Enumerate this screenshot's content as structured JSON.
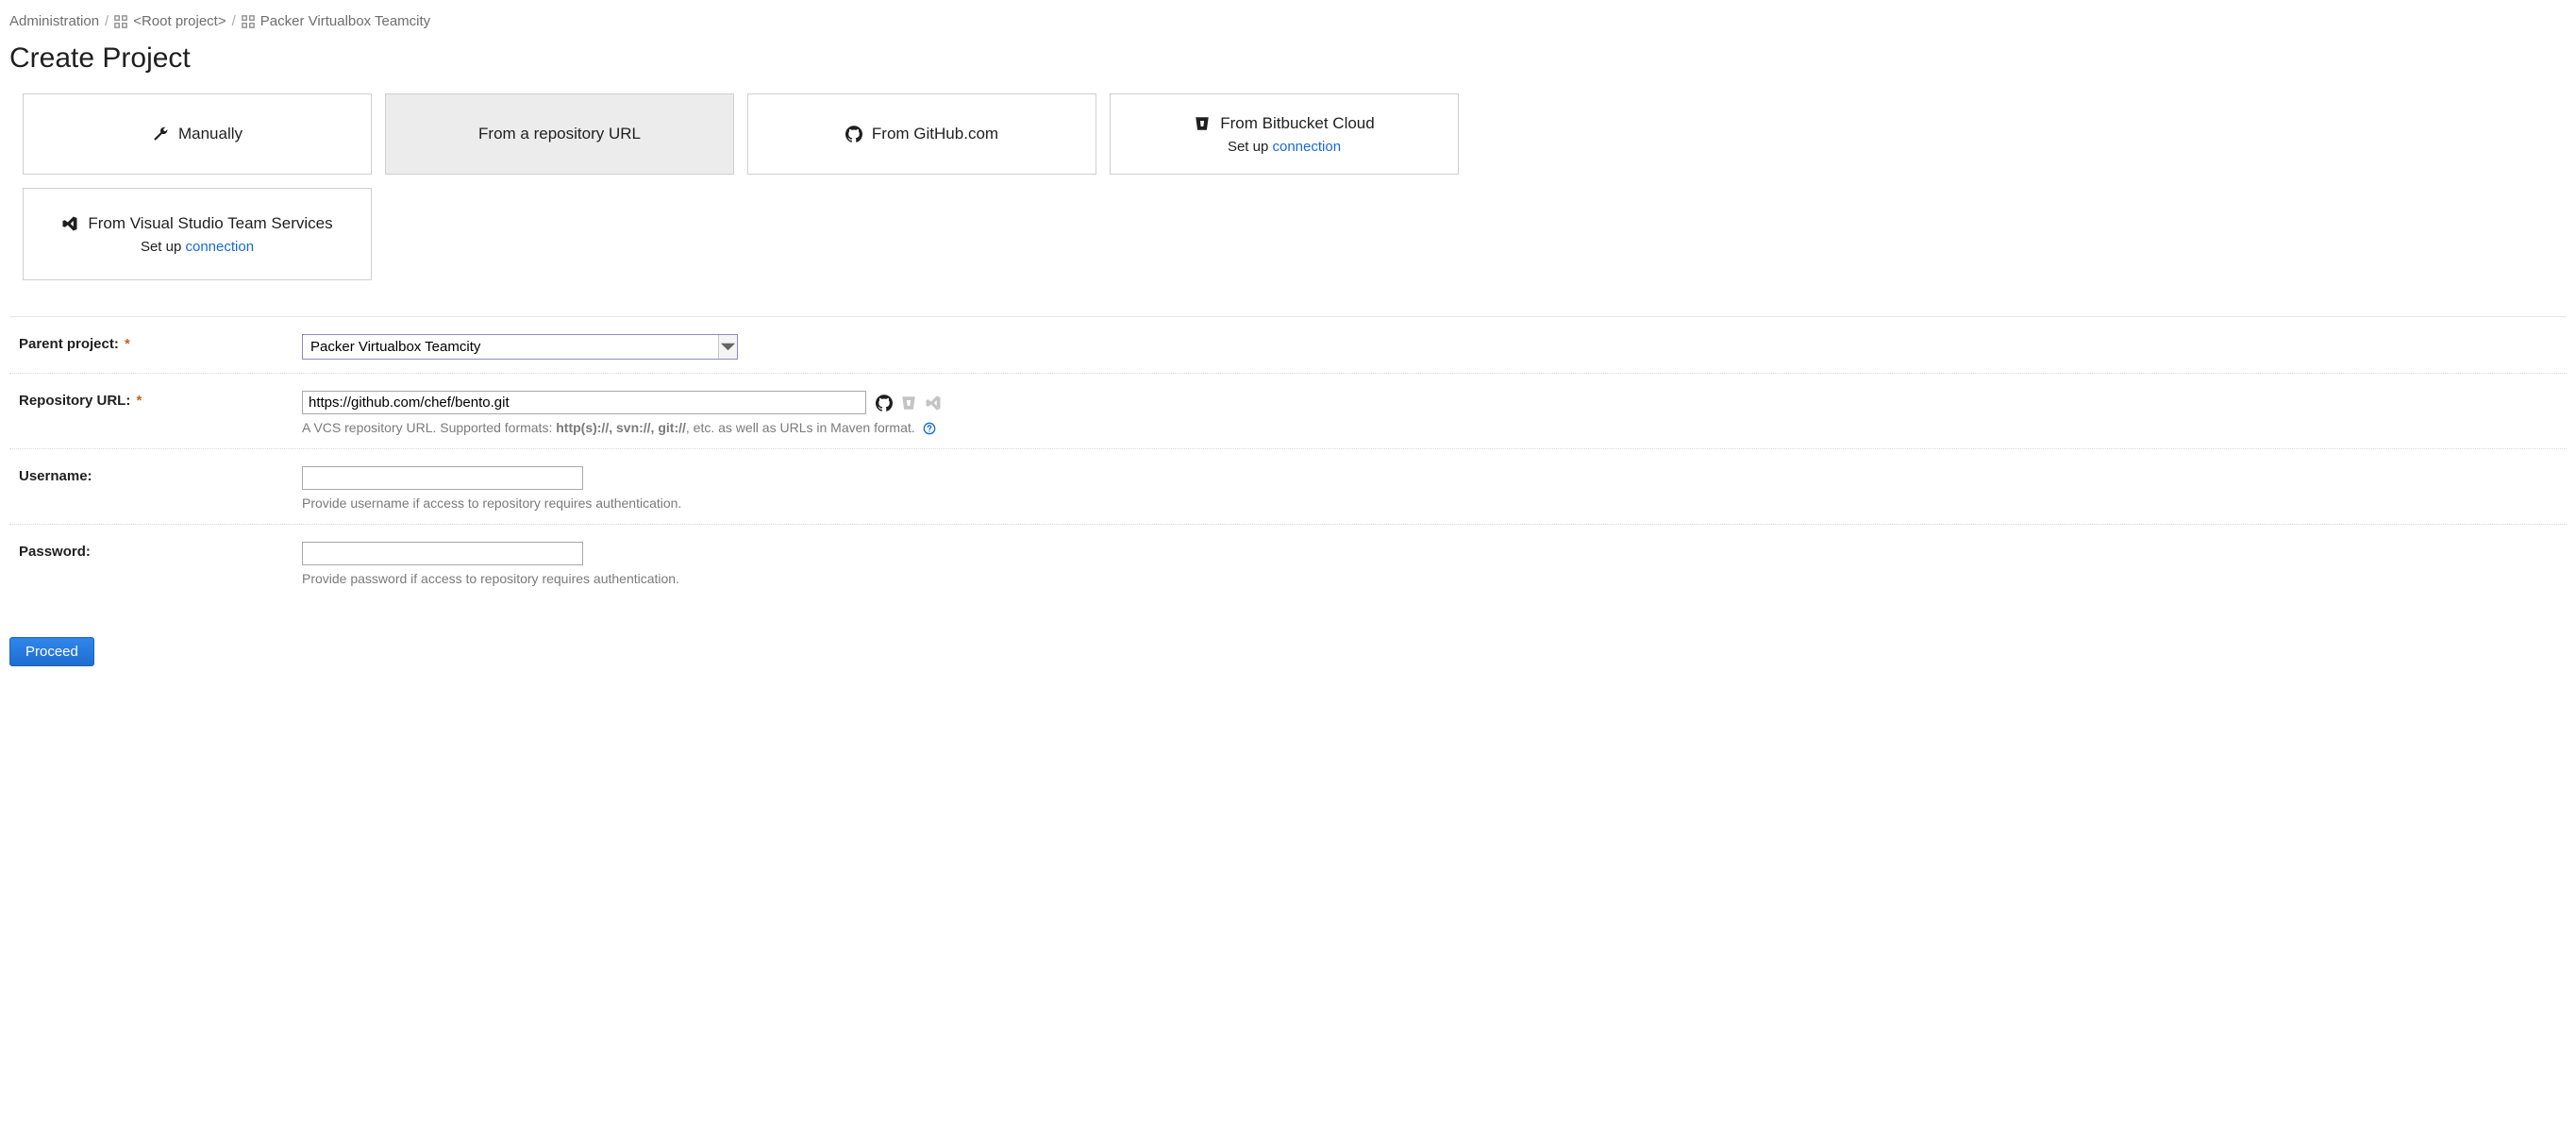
{
  "breadcrumb": {
    "admin": "Administration",
    "root": "<Root project>",
    "current": "Packer Virtualbox Teamcity"
  },
  "page_title": "Create Project",
  "tabs": {
    "manually": {
      "label": "Manually"
    },
    "repo_url": {
      "label": "From a repository URL"
    },
    "github": {
      "label": "From GitHub.com"
    },
    "bitbucket": {
      "label": "From Bitbucket Cloud",
      "setup_prefix": "Set up ",
      "setup_link": "connection"
    },
    "vsts": {
      "label": "From Visual Studio Team Services",
      "setup_prefix": "Set up ",
      "setup_link": "connection"
    }
  },
  "form": {
    "parent_project": {
      "label": "Parent project:",
      "value": "Packer Virtualbox Teamcity"
    },
    "repository_url": {
      "label": "Repository URL:",
      "value": "https://github.com/chef/bento.git",
      "hint_pre": "A VCS repository URL. Supported formats: ",
      "hint_strong": "http(s)://, svn://, git://",
      "hint_post": ", etc. as well as URLs in Maven format."
    },
    "username": {
      "label": "Username:",
      "value": "",
      "hint": "Provide username if access to repository requires authentication."
    },
    "password": {
      "label": "Password:",
      "value": "",
      "hint": "Provide password if access to repository requires authentication."
    }
  },
  "actions": {
    "proceed": "Proceed"
  },
  "required_marker": "*"
}
